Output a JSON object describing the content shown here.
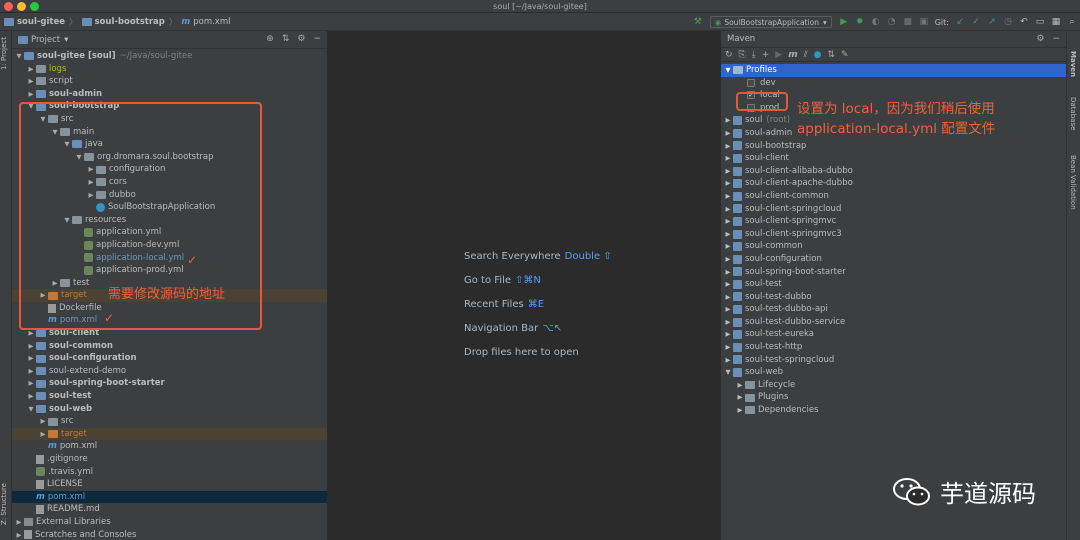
{
  "window": {
    "title": "soul [~/Java/soul-gitee]"
  },
  "breadcrumbs": [
    "soul-gitee",
    "soul-bootstrap",
    "pom.xml"
  ],
  "toolbar": {
    "run_config": "SoulBootstrapApplication",
    "git_label": "Git:"
  },
  "left_tabs": {
    "project": "1: Project",
    "structure": "Z: Structure"
  },
  "project_panel": {
    "title": "Project",
    "tree": [
      {
        "label": "soul-gitee [soul]",
        "extra": "~/Java/soul-gitee",
        "bold": true
      },
      {
        "label": "logs",
        "style": "yellow"
      },
      {
        "label": "script"
      },
      {
        "label": "soul-admin",
        "bold": true
      },
      {
        "label": "soul-bootstrap",
        "bold": true
      },
      {
        "label": "src"
      },
      {
        "label": "main"
      },
      {
        "label": "java"
      },
      {
        "label": "org.dromara.soul.bootstrap"
      },
      {
        "label": "configuration"
      },
      {
        "label": "cors"
      },
      {
        "label": "dubbo"
      },
      {
        "label": "SoulBootstrapApplication"
      },
      {
        "label": "resources"
      },
      {
        "label": "application.yml"
      },
      {
        "label": "application-dev.yml"
      },
      {
        "label": "application-local.yml",
        "style": "blue"
      },
      {
        "label": "application-prod.yml"
      },
      {
        "label": "test"
      },
      {
        "label": "target",
        "style": "orange"
      },
      {
        "label": "Dockerfile"
      },
      {
        "label": "pom.xml",
        "style": "blue"
      },
      {
        "label": "soul-client",
        "bold": true
      },
      {
        "label": "soul-common",
        "bold": true
      },
      {
        "label": "soul-configuration",
        "bold": true
      },
      {
        "label": "soul-extend-demo"
      },
      {
        "label": "soul-spring-boot-starter",
        "bold": true
      },
      {
        "label": "soul-test",
        "bold": true
      },
      {
        "label": "soul-web",
        "bold": true
      },
      {
        "label": "src"
      },
      {
        "label": "target",
        "style": "orange"
      },
      {
        "label": "pom.xml"
      },
      {
        "label": ".gitignore"
      },
      {
        "label": ".travis.yml"
      },
      {
        "label": "LICENSE"
      },
      {
        "label": "pom.xml",
        "style": "blue"
      },
      {
        "label": "README.md"
      },
      {
        "label": "External Libraries"
      },
      {
        "label": "Scratches and Consoles"
      }
    ]
  },
  "annotations": {
    "source_note": "需要修改源码的地址",
    "profile_note_line1": "设置为 local，因为我们稍后使用",
    "profile_note_line2": "application-local.yml 配置文件",
    "checkmark": "✓"
  },
  "editor_hints": [
    {
      "text": "Search Everywhere",
      "key": "Double ⇧"
    },
    {
      "text": "Go to File",
      "key": "⇧⌘N"
    },
    {
      "text": "Recent Files",
      "key": "⌘E"
    },
    {
      "text": "Navigation Bar",
      "key": "⌥↖"
    },
    {
      "text": "Drop files here to open",
      "key": ""
    }
  ],
  "maven_panel": {
    "title": "Maven",
    "profiles_label": "Profiles",
    "profiles": [
      {
        "label": "dev",
        "checked": false
      },
      {
        "label": "local",
        "checked": true
      },
      {
        "label": "prod",
        "checked": false
      }
    ],
    "root_module": {
      "label": "soul",
      "extra": "(root)"
    },
    "modules": [
      "soul-admin",
      "soul-bootstrap",
      "soul-client",
      "soul-client-alibaba-dubbo",
      "soul-client-apache-dubbo",
      "soul-client-common",
      "soul-client-springcloud",
      "soul-client-springmvc",
      "soul-client-springmvc3",
      "soul-common",
      "soul-configuration",
      "soul-spring-boot-starter",
      "soul-test",
      "soul-test-dubbo",
      "soul-test-dubbo-api",
      "soul-test-dubbo-service",
      "soul-test-eureka",
      "soul-test-http",
      "soul-test-springcloud",
      "soul-web"
    ],
    "web_children": [
      "Lifecycle",
      "Plugins",
      "Dependencies"
    ]
  },
  "right_tabs": {
    "maven": "Maven",
    "database": "Database",
    "bean": "Bean Validation"
  },
  "watermark": {
    "text": "芋道源码"
  },
  "colors": {
    "accent": "#2f65ca",
    "annotation": "#e8573a",
    "background": "#2b2b2b",
    "panel": "#3c3f41"
  }
}
